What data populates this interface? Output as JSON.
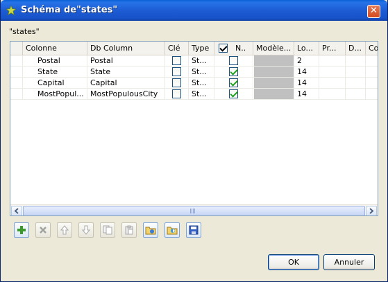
{
  "window": {
    "title": "Schéma de\"states\"",
    "close_glyph": "✕"
  },
  "schema_label": "\"states\"",
  "table": {
    "headers": {
      "colonne": "Colonne",
      "db_column": "Db Column",
      "cle": "Clé",
      "type": "Type",
      "nullable": "N..",
      "modele": "Modèle...",
      "longueur": "Lo...",
      "precision": "Pr...",
      "defaut": "D...",
      "commentaire": "Co"
    },
    "rows": [
      {
        "colonne": "Postal",
        "db_column": "Postal",
        "cle": false,
        "type": "St...",
        "nullable": false,
        "longueur": "2"
      },
      {
        "colonne": "State",
        "db_column": "State",
        "cle": false,
        "type": "St...",
        "nullable": true,
        "longueur": "14"
      },
      {
        "colonne": "Capital",
        "db_column": "Capital",
        "cle": false,
        "type": "St...",
        "nullable": true,
        "longueur": "14"
      },
      {
        "colonne": "MostPopul...",
        "db_column": "MostPopulousCity",
        "cle": false,
        "type": "St...",
        "nullable": true,
        "longueur": "14"
      }
    ]
  },
  "toolbar": {
    "add": "add-icon",
    "remove": "remove-icon",
    "move_up": "arrow-up-icon",
    "move_down": "arrow-down-icon",
    "copy": "copy-icon",
    "paste": "paste-icon",
    "import": "import-icon",
    "export": "export-icon",
    "save": "save-icon"
  },
  "buttons": {
    "ok": "OK",
    "cancel": "Annuler"
  },
  "colors": {
    "titlebar": "#1d5cd4",
    "window_bg": "#ece9d8",
    "check_green": "#21a121"
  }
}
